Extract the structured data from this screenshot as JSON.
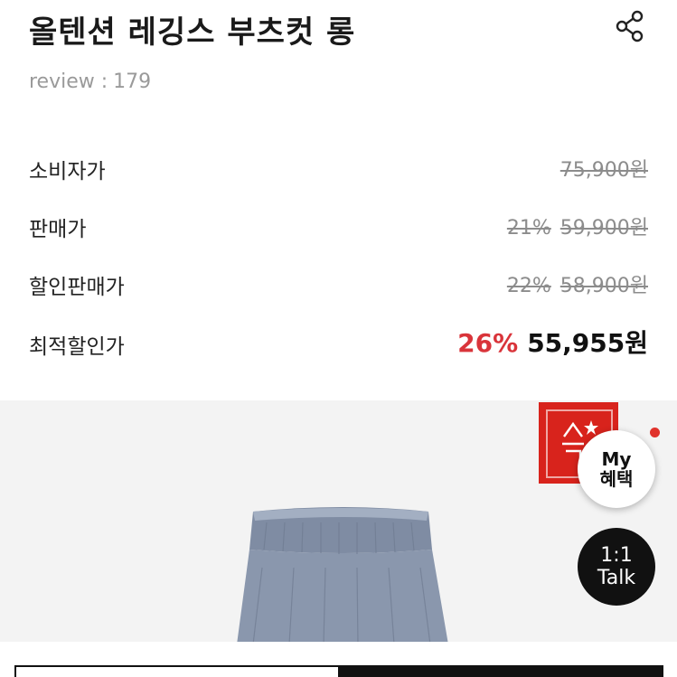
{
  "product": {
    "title": "올텐션 레깅스 부츠컷 롱",
    "review_label": "review :",
    "review_count": "179"
  },
  "prices": [
    {
      "label": "소비자가",
      "percent": "",
      "amount": "75,900원",
      "struck": true
    },
    {
      "label": "판매가",
      "percent": "21%",
      "amount": "59,900원",
      "struck": true
    },
    {
      "label": "할인판매가",
      "percent": "22%",
      "amount": "58,900원",
      "struck": true
    },
    {
      "label": "최적할인가",
      "percent": "26%",
      "amount": "55,955원",
      "struck": false
    }
  ],
  "floating": {
    "my_benefit_line1": "My",
    "my_benefit_line2": "혜택",
    "talk_line1": "1:1",
    "talk_line2": "Talk"
  },
  "icons": {
    "share": "share-icon",
    "brand": "brand-logo",
    "product": "product-image"
  },
  "colors": {
    "accent_red": "#d9343a",
    "brand_red": "#d8231c",
    "muted_text": "#8c8c8c",
    "dark": "#111111"
  }
}
